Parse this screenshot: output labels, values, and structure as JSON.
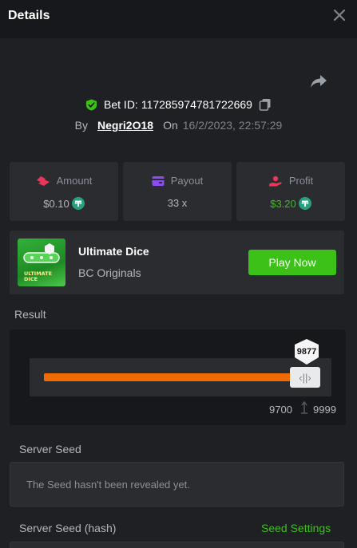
{
  "header": {
    "title": "Details"
  },
  "bet": {
    "id_label": "Bet ID:",
    "id_value": "117285974781722669",
    "by_label": "By",
    "username": "Negri2O18",
    "on_label": "On",
    "timestamp": "16/2/2023, 22:57:29"
  },
  "stats": {
    "amount": {
      "label": "Amount",
      "value": "$0.10"
    },
    "payout": {
      "label": "Payout",
      "value": "33 x"
    },
    "profit": {
      "label": "Profit",
      "value": "$3.20"
    }
  },
  "game": {
    "name": "Ultimate Dice",
    "provider": "BC Originals",
    "play_label": "Play Now",
    "thumb_text": "ULTIMATE DICE"
  },
  "result": {
    "label": "Result",
    "value": "9877",
    "range_min": "9700",
    "range_max": "9999"
  },
  "seeds": {
    "server_seed_label": "Server Seed",
    "server_seed_text": "The Seed hasn't been revealed yet.",
    "server_seed_hash_label": "Server Seed (hash)",
    "seed_settings_label": "Seed Settings"
  },
  "colors": {
    "accent_green": "#3bc117",
    "bar_orange": "#f06a06",
    "background": "#1e2023"
  },
  "icons": [
    "close-icon",
    "share-icon",
    "shield-check-icon",
    "copy-icon",
    "amount-icon",
    "payout-icon",
    "profit-icon",
    "tether-icon"
  ]
}
